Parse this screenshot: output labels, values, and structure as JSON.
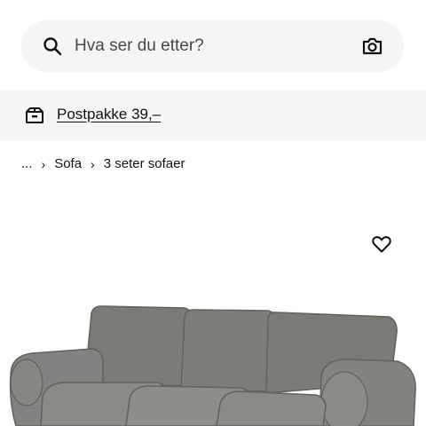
{
  "search": {
    "placeholder": "Hva ser du etter?",
    "search_icon": "search-icon",
    "camera_icon": "camera-icon"
  },
  "delivery": {
    "icon": "parcel-box-icon",
    "link_text": "Postpakke 39,–"
  },
  "breadcrumb": {
    "ellipsis": "...",
    "separator": "›",
    "items": [
      "Sofa",
      "3 seter sofaer"
    ]
  },
  "product": {
    "favourite_icon": "heart-icon",
    "image": "grey-three-seat-sofa",
    "colors": {
      "fabric": "#7d7d78",
      "fabric_dark": "#5f5f5a",
      "fabric_light": "#8e8e89"
    }
  }
}
